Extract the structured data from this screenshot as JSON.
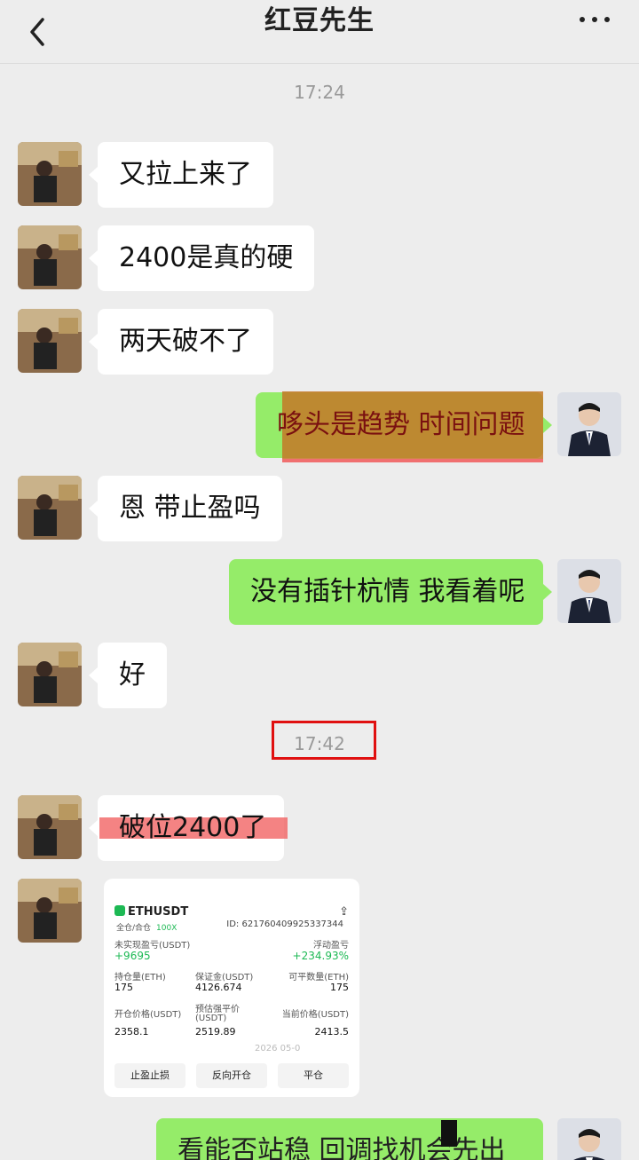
{
  "header": {
    "title": "红豆先生"
  },
  "times": [
    "17:24",
    "17:42"
  ],
  "messages": {
    "m1": "又拉上来了",
    "m2": "2400是真的硬",
    "m3": "两天破不了",
    "m4": "哆头是趋势 时间问题",
    "m5": "恩 带止盈吗",
    "m6": "没有插针杭情 我看着呢",
    "m7": "好",
    "m8": "破位2400了",
    "m9": "看能否站稳   回调找机会先出"
  },
  "trade_card": {
    "symbol": "ETHUSDT",
    "mode": "全仓/合仓",
    "leverage": "100X",
    "id": "ID: 621760409925337344",
    "unrealized_label": "未实现盈亏(USDT)",
    "unrealized_value": "+9695",
    "roe_label": "浮动盈亏",
    "roe_value": "+234.93%",
    "pos_label": "持仓量(ETH)",
    "pos_value": "175",
    "margin_label": "保证金(USDT)",
    "margin_value": "4126.674",
    "closable_label": "可平数量(ETH)",
    "closable_value": "175",
    "open_label": "开仓价格(USDT)",
    "open_value": "2358.1",
    "liq_label1": "预估强平价",
    "liq_label2": "(USDT)",
    "liq_value": "2519.89",
    "cur_label": "当前价格(USDT)",
    "cur_value": "2413.5",
    "timestamp": "2026 05-0",
    "btn1": "止盈止损",
    "btn2": "反向开仓",
    "btn3": "平仓"
  }
}
